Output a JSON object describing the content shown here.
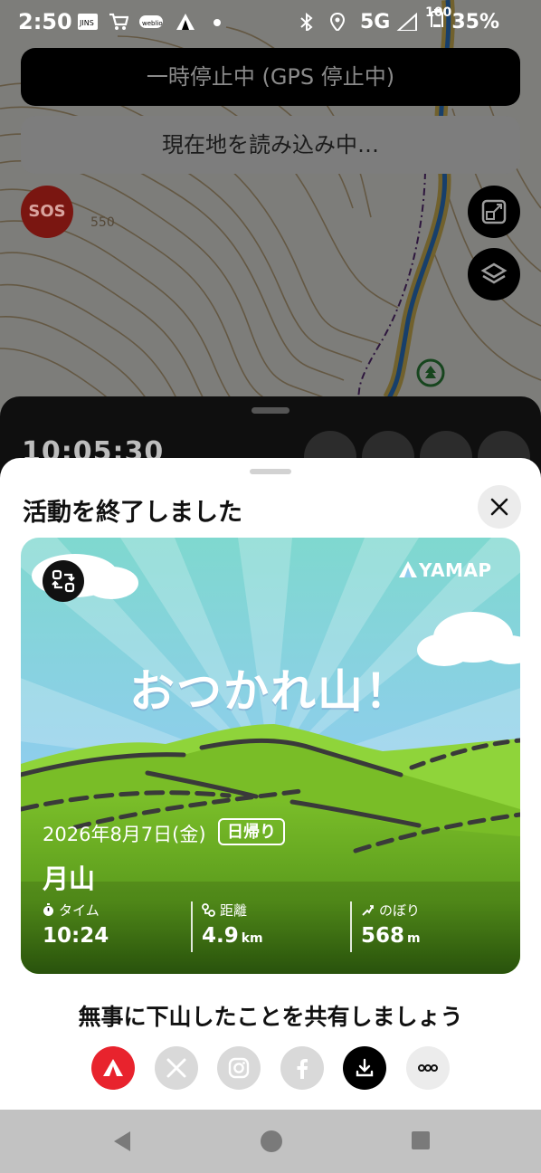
{
  "status_bar": {
    "time": "2:50",
    "network": "5G",
    "battery": "35%",
    "icons": [
      "jins-icon",
      "cart-icon",
      "weblio-icon",
      "yamap-icon",
      "dot-icon",
      "bluetooth-icon",
      "location-icon",
      "signal-icon",
      "battery-icon"
    ],
    "overlay_small": "100"
  },
  "map": {
    "gps_status": "一時停止中 (GPS 停止中)",
    "location_status": "現在地を読み込み中…",
    "sos_label": "SOS",
    "elevation_label": "550"
  },
  "activity_panel": {
    "elapsed_time": "10:05:30"
  },
  "sheet": {
    "title": "活動を終了しました",
    "card": {
      "brand": "YAMAP",
      "headline": "おつかれ山！",
      "date": "2026年8月7日(金)",
      "trip_type": "日帰り",
      "mountain": "月山",
      "stats": [
        {
          "label": "タイム",
          "value": "10:24",
          "unit": "",
          "icon": "timer-icon"
        },
        {
          "label": "距離",
          "value": "4.9",
          "unit": "km",
          "icon": "route-icon"
        },
        {
          "label": "のぼり",
          "value": "568",
          "unit": "m",
          "icon": "ascent-icon"
        }
      ]
    },
    "share_prompt": "無事に下山したことを共有しましょう",
    "share_targets": [
      "yamap",
      "x",
      "instagram",
      "facebook",
      "download",
      "more"
    ]
  },
  "colors": {
    "yamap_red": "#e8232d",
    "dark": "#111111",
    "share_gray": "#d9d9d9"
  }
}
